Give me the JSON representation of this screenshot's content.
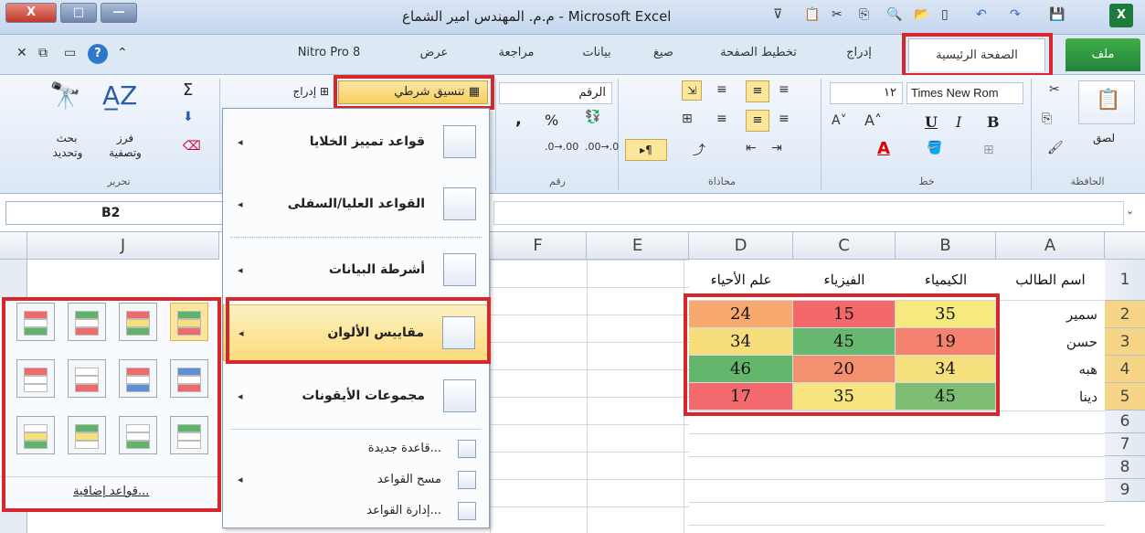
{
  "window": {
    "title": "م.م. المهندس امير الشماع - Microsoft Excel",
    "controls": [
      "X",
      "□",
      "—"
    ]
  },
  "tabs": {
    "file": "ملف",
    "home": "الصفحة الرئيسية",
    "insert": "إدراج",
    "page_layout": "تخطيط الصفحة",
    "formulas": "صيغ",
    "data": "بيانات",
    "review": "مراجعة",
    "view": "عرض",
    "nitro": "Nitro Pro 8"
  },
  "ribbon": {
    "clipboard": {
      "label": "الحافظة",
      "paste": "لصق"
    },
    "font": {
      "label": "خط",
      "name": "Times New Rom",
      "size": "١٢",
      "bold": "B",
      "italic": "I",
      "underline": "U"
    },
    "alignment": {
      "label": "محاذاة"
    },
    "number": {
      "label": "رقم",
      "format": "الرقم",
      "percent": "%",
      "comma": ","
    },
    "styles": {
      "conditional_formatting": "تنسيق شرطي",
      "insert": "إدراج"
    },
    "editing": {
      "label": "تحرير",
      "sort_filter_line1": "فرز",
      "sort_filter_line2": "وتصفية",
      "find_select_line1": "بحث",
      "find_select_line2": "وتحديد",
      "sum": "Σ"
    }
  },
  "formula_bar": {
    "name_box": "B2"
  },
  "sheet": {
    "columns": [
      "A",
      "B",
      "C",
      "D",
      "E",
      "F",
      "J"
    ],
    "rows": [
      "1",
      "2",
      "3",
      "4",
      "5",
      "6",
      "7",
      "8",
      "9"
    ],
    "headers": {
      "A": "اسم الطالب",
      "B": "الكيمياء",
      "C": "الفيزياء",
      "D": "علم الأحياء"
    },
    "students": [
      {
        "name": "سمير",
        "B": "35",
        "C": "15",
        "D": "24"
      },
      {
        "name": "حسن",
        "B": "19",
        "C": "45",
        "D": "34"
      },
      {
        "name": "هبه",
        "B": "34",
        "C": "20",
        "D": "46"
      },
      {
        "name": "دينا",
        "B": "45",
        "C": "35",
        "D": "17"
      }
    ],
    "cell_colors": [
      [
        "#f6e97e",
        "#f2686b",
        "#f7a970"
      ],
      [
        "#f3826f",
        "#68b96f",
        "#f7dd7c"
      ],
      [
        "#f6e07e",
        "#f2906f",
        "#64b66c"
      ],
      [
        "#7ebd73",
        "#f7e47e",
        "#f26a6d"
      ]
    ]
  },
  "menu": {
    "items": [
      {
        "label": "قواعد تمييز الخلايا"
      },
      {
        "label": "القواعد العليا/السفلى"
      },
      {
        "label": "أشرطة البيانات"
      },
      {
        "label": "مقاييس الألوان"
      },
      {
        "label": "مجموعات الأيقونات"
      }
    ],
    "sub_items": [
      {
        "label": "قاعدة جديدة..."
      },
      {
        "label": "مسح القواعد"
      },
      {
        "label": "إدارة القواعد..."
      }
    ]
  },
  "color_scales": {
    "more_rules": "قواعد إضافية...",
    "swatches": [
      [
        "#5fb36a",
        "#f6e07a",
        "#ee6b6b"
      ],
      [
        "#ee6b6b",
        "#f6e07a",
        "#5fb36a"
      ],
      [
        "#5fb36a",
        "#ffffff",
        "#ee6b6b"
      ],
      [
        "#ee6b6b",
        "#ffffff",
        "#5fb36a"
      ],
      [
        "#5b8fd6",
        "#ffffff",
        "#ee6b6b"
      ],
      [
        "#ee6b6b",
        "#ffffff",
        "#5b8fd6"
      ],
      [
        "#ffffff",
        "#ffffff",
        "#ee6b6b"
      ],
      [
        "#ee6b6b",
        "#ffffff",
        "#ffffff"
      ],
      [
        "#5fb36a",
        "#ffffff",
        "#ffffff"
      ],
      [
        "#ffffff",
        "#ffffff",
        "#5fb36a"
      ],
      [
        "#5fb36a",
        "#f6e07a",
        "#ffffff"
      ],
      [
        "#ffffff",
        "#f6e07a",
        "#5fb36a"
      ]
    ]
  }
}
